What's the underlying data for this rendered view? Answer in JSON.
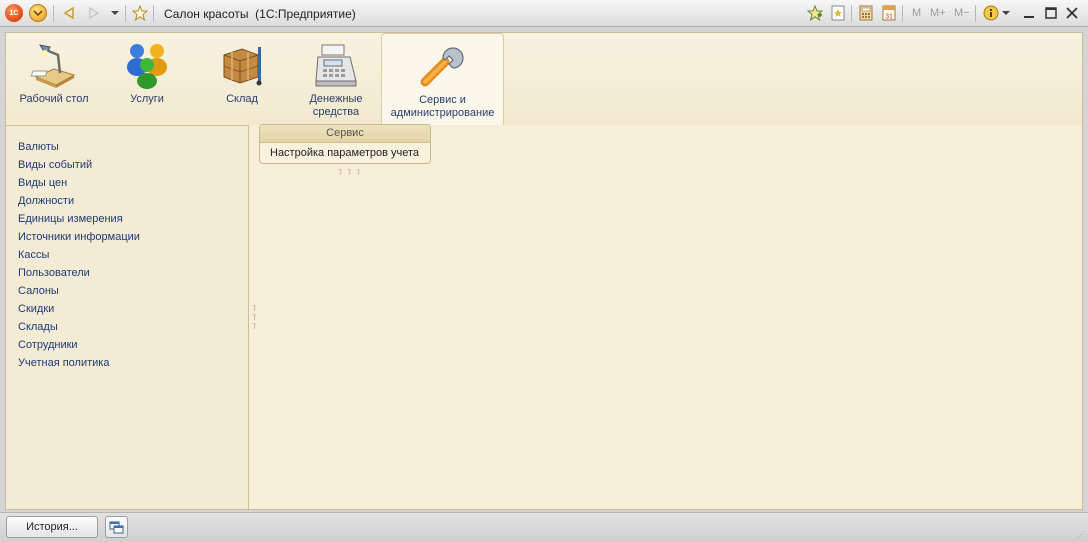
{
  "titlebar": {
    "app_logo_text": "1С",
    "title": "Салон красоты  (1С:Предприятие)",
    "m_label": "M",
    "m_plus_label": "M+",
    "m_minus_label": "M−",
    "calendar_day": "31"
  },
  "sections": [
    {
      "label": "Рабочий стол",
      "icon": "desk-lamp-icon"
    },
    {
      "label": "Услуги",
      "icon": "people-icon"
    },
    {
      "label": "Склад",
      "icon": "warehouse-boxes-icon"
    },
    {
      "label": "Денежные средства",
      "icon": "cash-register-icon"
    },
    {
      "label": "Сервис и администрирование",
      "icon": "wrench-icon",
      "active": true
    }
  ],
  "leftnav": {
    "items": [
      "Валюты",
      "Виды событий",
      "Виды цен",
      "Должности",
      "Единицы измерения",
      "Источники информации",
      "Кассы",
      "Пользователи",
      "Салоны",
      "Скидки",
      "Склады",
      "Сотрудники",
      "Учетная политика"
    ]
  },
  "content": {
    "group_title": "Сервис",
    "group_items": [
      "Настройка параметров учета"
    ]
  },
  "statusbar": {
    "history_label": "История..."
  },
  "colors": {
    "panel_bg": "#f6eed8",
    "link_text": "#1f3a7a",
    "section_text": "#2a3d6b"
  }
}
